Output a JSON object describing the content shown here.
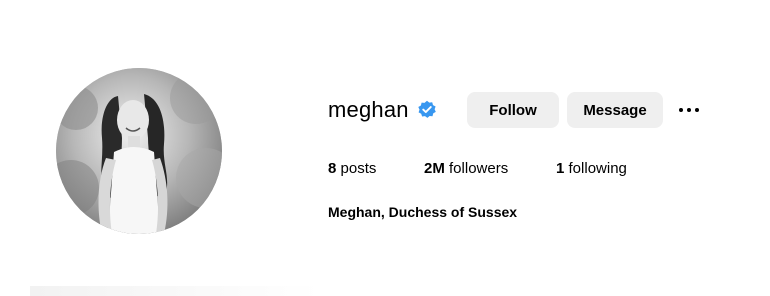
{
  "profile": {
    "username": "meghan",
    "verified_icon": "verified-badge-icon",
    "verified_color": "#3897f0",
    "follow_label": "Follow",
    "message_label": "Message",
    "more_icon": "more-options-icon",
    "stats": {
      "posts_count": "8",
      "posts_label": "posts",
      "followers_count": "2M",
      "followers_label": "followers",
      "following_count": "1",
      "following_label": "following"
    },
    "full_name": "Meghan, Duchess of Sussex"
  }
}
